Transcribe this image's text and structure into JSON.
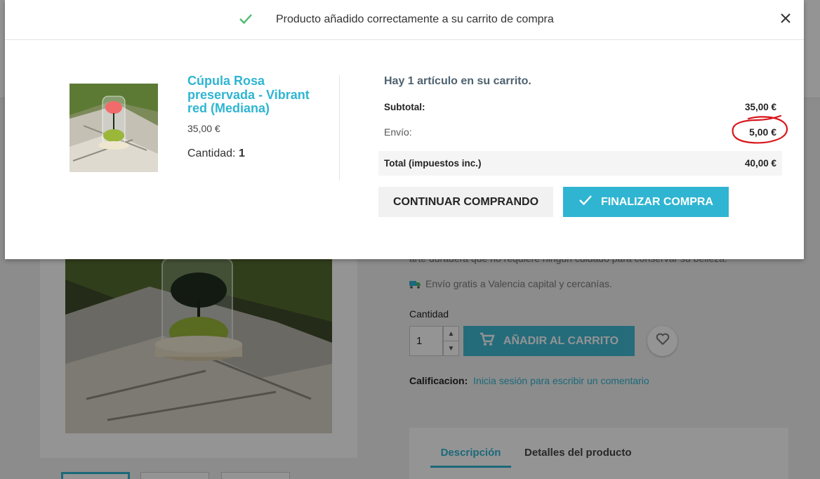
{
  "colors": {
    "accent": "#2fb5d2",
    "success_check": "#4cbb6c",
    "annotation_red": "#d8161b"
  },
  "modal": {
    "title": "Producto añadido correctamente a su carrito de compra",
    "check_icon": "check-icon",
    "close_icon": "close-icon",
    "product": {
      "name": "Cúpula Rosa preservada - Vibrant red (Mediana)",
      "price": "35,00 €",
      "quantity_label": "Cantidad:",
      "quantity_value": "1"
    },
    "cart": {
      "count_text": "Hay 1 artículo en su carrito.",
      "subtotal_label": "Subtotal:",
      "subtotal_value": "35,00 €",
      "shipping_label": "Envío:",
      "shipping_value": "5,00 €",
      "total_label": "Total (impuestos inc.)",
      "total_value": "40,00 €"
    },
    "buttons": {
      "continue": "CONTINUAR COMPRANDO",
      "checkout": "FINALIZAR COMPRA"
    }
  },
  "page": {
    "description_line": "arte duradera que no requiere ningún cuidado para conservar su belleza.",
    "shipping_note": "Envío gratis a Valencia capital y cercanías.",
    "quantity_label": "Cantidad",
    "quantity_value": "1",
    "add_to_cart": "AÑADIR AL CARRITO",
    "rating_label": "Calificacion:",
    "rating_link": "Inicia sesión para escribir un comentario",
    "tabs": [
      "Descripción",
      "Detalles del producto"
    ]
  }
}
